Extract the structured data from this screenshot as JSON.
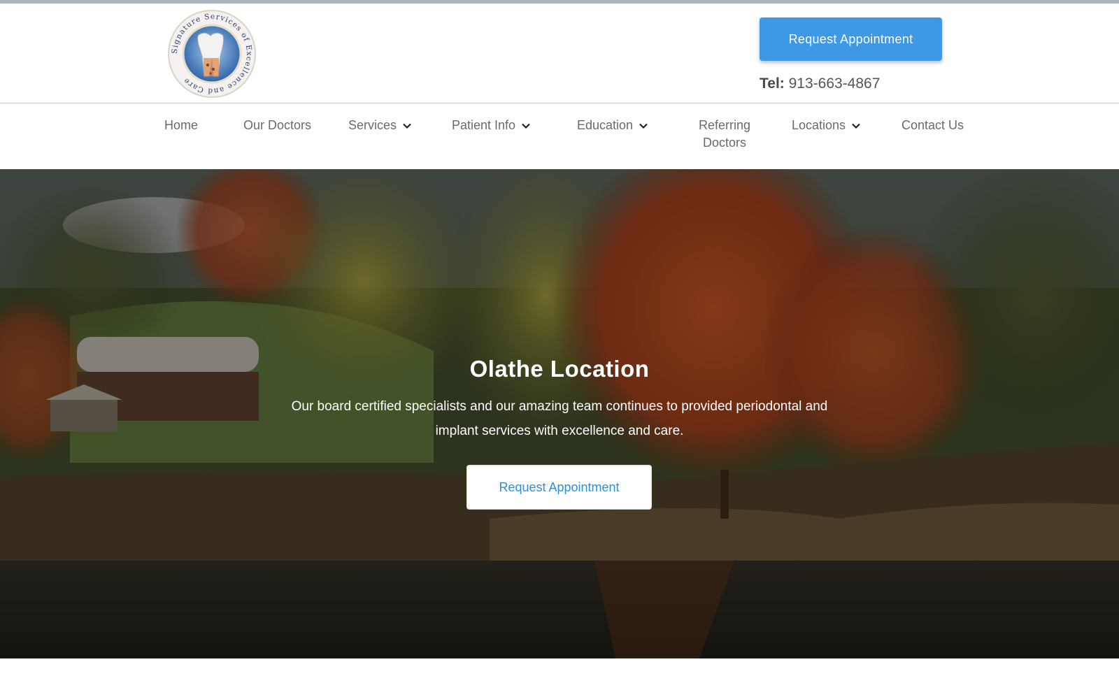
{
  "colors": {
    "accent": "#3f98e4",
    "top_strip": "#a9b4bf",
    "nav_text": "#6a6a6a",
    "hero_button_text": "#2f8fd6"
  },
  "header": {
    "logo_icon": "tooth-emblem-logo",
    "logo_ring_text": "Signature Services of Excellence and Care",
    "request_button_label": "Request Appointment",
    "tel_label": "Tel:",
    "tel_number": "913-663-4867"
  },
  "nav": {
    "items": [
      {
        "label": "Home",
        "has_dropdown": false
      },
      {
        "label": "Our Doctors",
        "has_dropdown": false
      },
      {
        "label": "Services",
        "has_dropdown": true
      },
      {
        "label": "Patient Info",
        "has_dropdown": true
      },
      {
        "label": "Education",
        "has_dropdown": true
      },
      {
        "label": "Referring Doctors",
        "has_dropdown": false
      },
      {
        "label": "Locations",
        "has_dropdown": true
      },
      {
        "label": "Contact Us",
        "has_dropdown": false
      }
    ],
    "dropdown_icon": "chevron-down-icon"
  },
  "hero": {
    "title": "Olathe Location",
    "text": "Our board certified specialists and our amazing team continues to provided periodontal and implant services with excellence and care.",
    "button_label": "Request Appointment",
    "background": "autumn-trees-lake-photo"
  }
}
